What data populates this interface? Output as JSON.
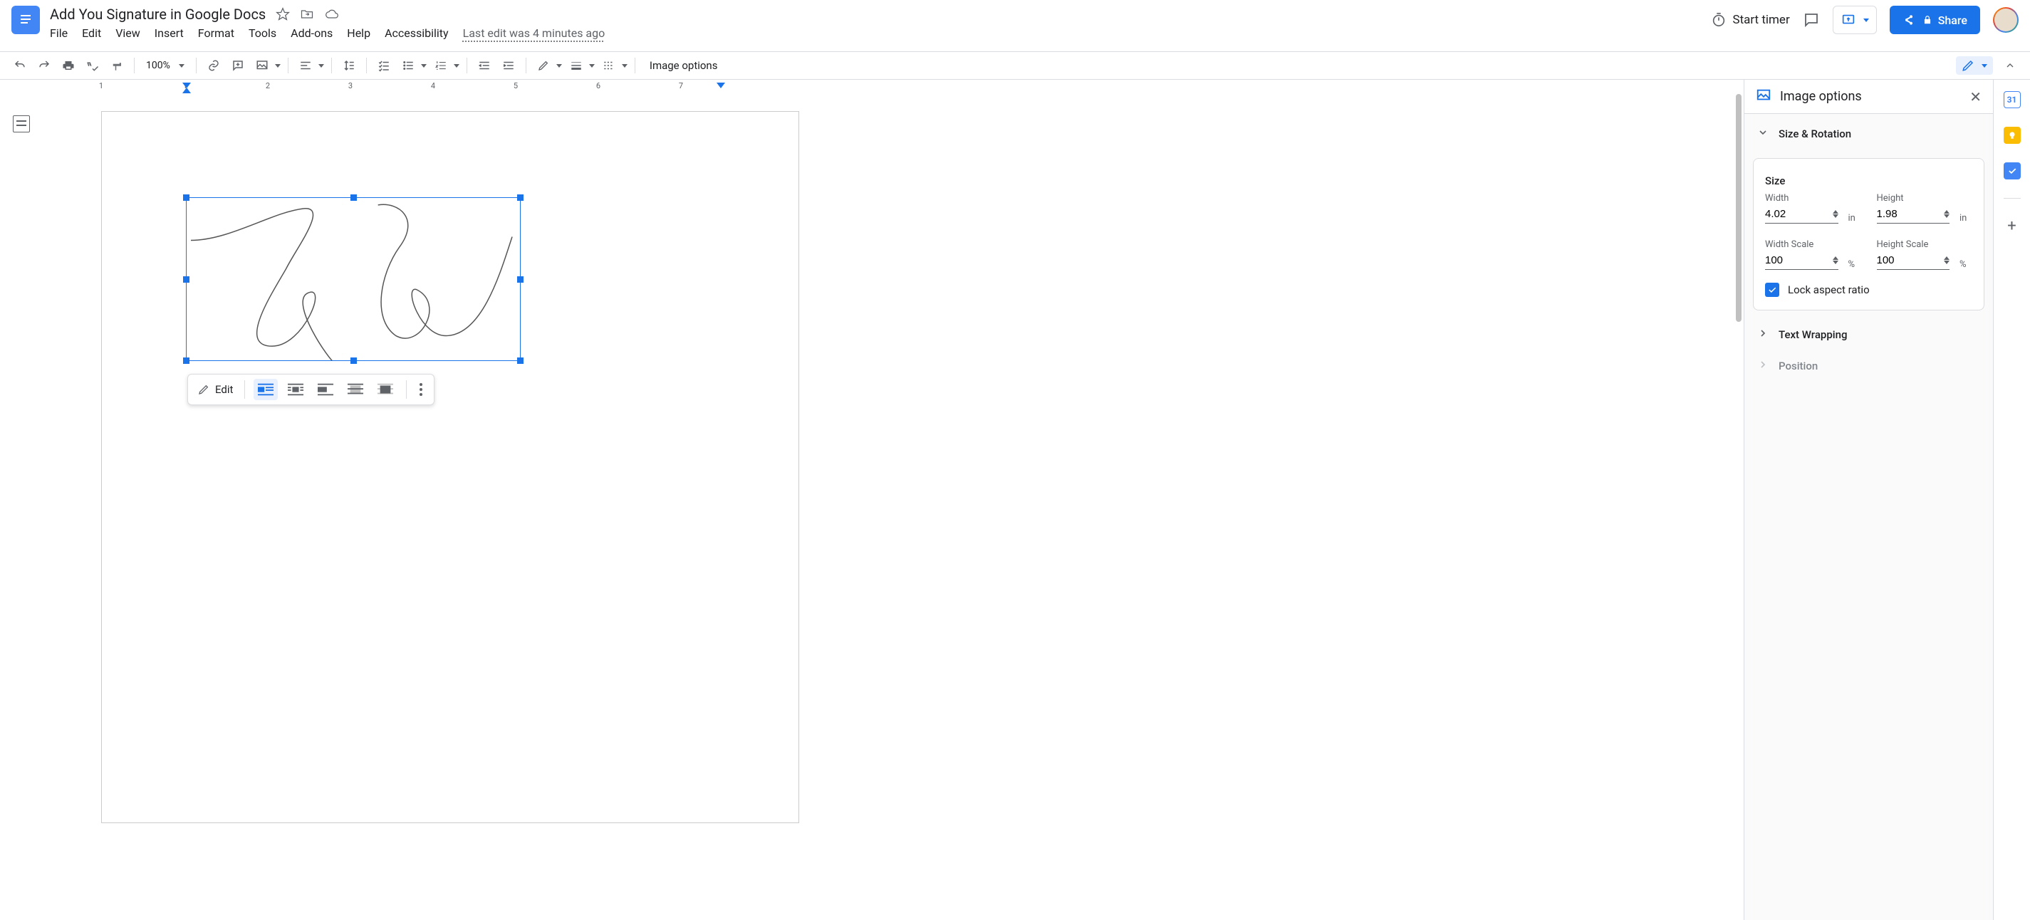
{
  "header": {
    "title": "Add You Signature in Google Docs",
    "last_edit": "Last edit was 4 minutes ago",
    "start_timer": "Start timer",
    "share_label": "Share"
  },
  "menubar": {
    "items": [
      "File",
      "Edit",
      "View",
      "Insert",
      "Format",
      "Tools",
      "Add-ons",
      "Help",
      "Accessibility"
    ]
  },
  "toolbar": {
    "zoom": "100%",
    "image_options_label": "Image options"
  },
  "float_toolbar": {
    "edit_label": "Edit"
  },
  "panel": {
    "title": "Image options",
    "section_size": "Size & Rotation",
    "section_wrap": "Text Wrapping",
    "section_pos": "Position",
    "size_heading": "Size",
    "width_label": "Width",
    "height_label": "Height",
    "width_val": "4.02",
    "height_val": "1.98",
    "unit_in": "in",
    "wscale_label": "Width Scale",
    "hscale_label": "Height Scale",
    "wscale_val": "100",
    "hscale_val": "100",
    "unit_pct": "%",
    "lock_label": "Lock aspect ratio"
  },
  "ruler": {
    "nums": [
      "1",
      "2",
      "3",
      "4",
      "5",
      "6",
      "7"
    ],
    "left_margin_tick": "1"
  }
}
